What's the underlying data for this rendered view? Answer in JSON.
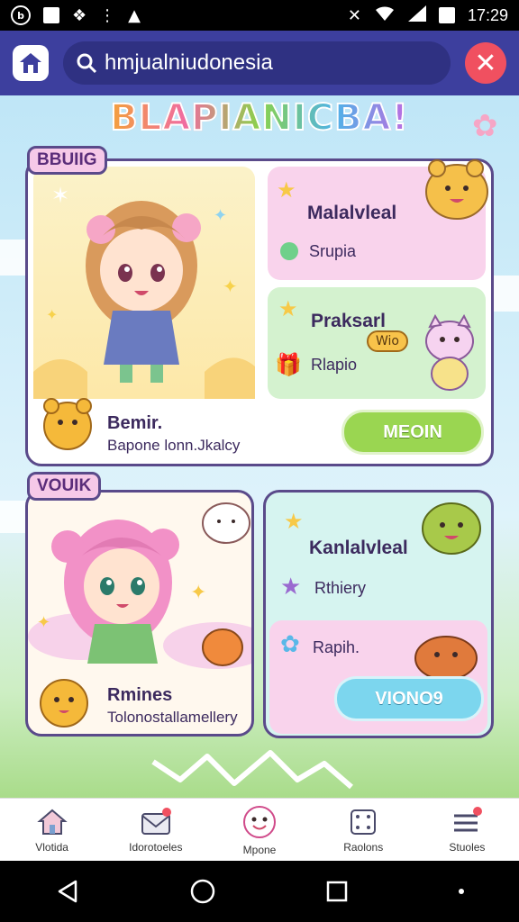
{
  "status_bar": {
    "time": "17:29"
  },
  "search": {
    "query": "hmjualniudonesia"
  },
  "banner": {
    "title": "BLAPIANICBA!"
  },
  "section1": {
    "label": "BBUIIG",
    "character": {
      "name": "Bemir.",
      "description": "Bapone lonn.Jkalcy"
    },
    "tile1": {
      "title": "Malalvleal",
      "subtitle": "Srupia"
    },
    "tile2": {
      "title": "Praksarl",
      "subtitle": "Rlapio",
      "bubble": "Wio"
    },
    "button": "MEOIN"
  },
  "section2": {
    "label": "VOUIK",
    "character": {
      "name": "Rmines",
      "description": "Tolonostallamellery"
    },
    "tile1": {
      "title": "Kanlalvleal",
      "subtitle": "Rthiery"
    },
    "tile2": {
      "subtitle": "Rapih."
    },
    "button": "VIONO9"
  },
  "bottom_nav": [
    {
      "label": "Vlotida",
      "icon": "home-icon"
    },
    {
      "label": "Idorotoeles",
      "icon": "mail-icon"
    },
    {
      "label": "Mpone",
      "icon": "smile-icon"
    },
    {
      "label": "Raolons",
      "icon": "dice-icon"
    },
    {
      "label": "Stuoles",
      "icon": "menu-icon"
    }
  ],
  "colors": {
    "app_bar": "#3d3f9e",
    "close": "#f05060",
    "tile_pink": "#f9d3ec",
    "tile_green": "#d4f2cf",
    "tile_mint": "#d6f4f0",
    "button_green": "#9ad651",
    "button_blue": "#7cd6ee"
  }
}
